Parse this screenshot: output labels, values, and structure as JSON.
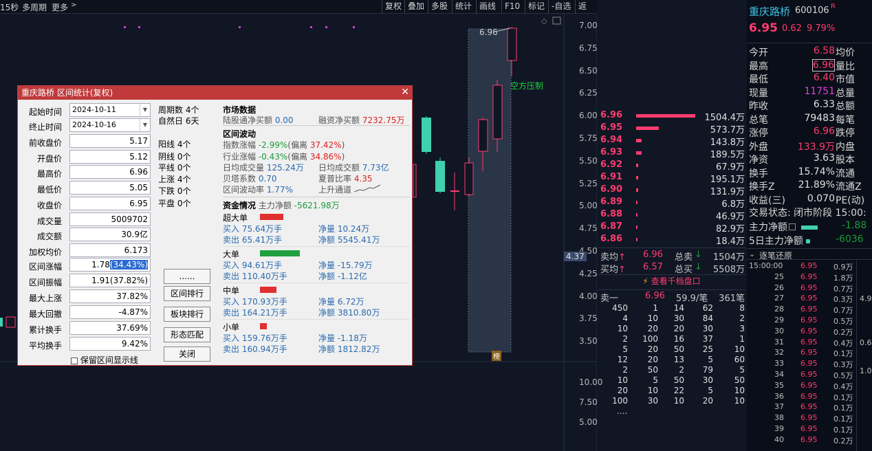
{
  "toolbar": {
    "period": "15秒",
    "multi": "多周期",
    "more": "更多",
    "buttons": [
      "复权",
      "叠加",
      "多股",
      "统计",
      "画线",
      "F10",
      "标记",
      "-自选",
      "返回"
    ]
  },
  "yaxis": [
    "7.00",
    "6.75",
    "6.50",
    "6.25",
    "6.00",
    "5.75",
    "5.50",
    "5.25",
    "5.00",
    "4.75",
    "4.50",
    "4.25",
    "4.00",
    "3.75",
    "3.50"
  ],
  "vol_axis": [
    "10.00",
    "7.50",
    "5.00"
  ],
  "price_tag": "4.37",
  "chart": {
    "high_label": "6.96",
    "annotation": "空方压制",
    "rank_tag": "榜"
  },
  "dialog": {
    "title": "重庆路桥 区间统计(复权)",
    "start_label": "起始时间",
    "start": "2024-10-11",
    "end_label": "终止时间",
    "end": "2024-10-16",
    "fields": [
      [
        "前收盘价",
        "5.17"
      ],
      [
        "开盘价",
        "5.12"
      ],
      [
        "最高价",
        "6.96"
      ],
      [
        "最低价",
        "5.05"
      ],
      [
        "收盘价",
        "6.95"
      ],
      [
        "成交量",
        "5009702"
      ],
      [
        "成交额",
        "30.9亿"
      ],
      [
        "加权均价",
        "6.173"
      ]
    ],
    "zf_label": "区间涨幅",
    "zf_val": "1.78",
    "zf_sel": "(34.43%)",
    "fields2": [
      [
        "区间振幅",
        "1.91(37.82%)"
      ],
      [
        "最大上涨",
        "37.82%"
      ],
      [
        "最大回撤",
        "-4.87%"
      ],
      [
        "累计换手",
        "37.69%"
      ],
      [
        "平均换手",
        "9.42%"
      ]
    ],
    "checkbox": "保留区间显示线",
    "mid": [
      "周期数 4个",
      "自然日 6天",
      "阳线 4个",
      "阴线 0个",
      "平线 0个",
      "上涨 4个",
      "下跌 0个",
      "平盘 0个"
    ],
    "buttons": [
      "......",
      "区间排行",
      "板块排行",
      "形态匹配",
      "关闭"
    ],
    "market_title": "市场数据",
    "lgt_label": "陆股通净买额",
    "lgt_val": "0.00",
    "rz_label": "融资净买额",
    "rz_val": "7232.75万",
    "wave_title": "区间波动",
    "idx_label": "指数涨幅",
    "idx_val": "-2.99%",
    "idx_dev": "(偏离 37.42%)",
    "ind_label": "行业涨幅",
    "ind_val": "-0.43%",
    "ind_dev": "(偏离 34.86%)",
    "avgv_label": "日均成交量",
    "avgv_val": "125.24万",
    "avga_label": "日均成交额",
    "avga_val": "7.73亿",
    "beta_label": "贝塔系数",
    "beta_val": "0.70",
    "sharpe_label": "夏普比率",
    "sharpe_val": "4.35",
    "vol_label": "区间波动率",
    "vol_val": "1.77%",
    "chan_label": "上升通道",
    "fund_title": "资金情况",
    "main_net": "主力净额 -5621.98万",
    "groups": [
      {
        "name": "超大单",
        "buy": "买入 75.64万手",
        "sell": "卖出 65.41万手",
        "net1": "净量 10.24万",
        "net2": "净额 5545.41万"
      },
      {
        "name": "大单",
        "buy": "买入 94.61万手",
        "sell": "卖出 110.40万手",
        "net1": "净量 -15.79万",
        "net2": "净额 -1.12亿"
      },
      {
        "name": "中单",
        "buy": "买入 170.93万手",
        "sell": "卖出 164.21万手",
        "net1": "净量 6.72万",
        "net2": "净额 3810.80万"
      },
      {
        "name": "小单",
        "buy": "买入 159.76万手",
        "sell": "卖出 160.94万手",
        "net1": "净量 -1.18万",
        "net2": "净额 1812.82万"
      }
    ]
  },
  "orderbook": [
    [
      "6.96",
      "1504.4万"
    ],
    [
      "6.95",
      "573.7万"
    ],
    [
      "6.94",
      "143.8万"
    ],
    [
      "6.93",
      "189.5万"
    ],
    [
      "6.92",
      "67.9万"
    ],
    [
      "6.91",
      "195.1万"
    ],
    [
      "6.90",
      "131.9万"
    ],
    [
      "6.89",
      "6.8万"
    ],
    [
      "6.88",
      "46.9万"
    ],
    [
      "6.87",
      "82.9万"
    ],
    [
      "6.86",
      "18.4万"
    ]
  ],
  "sell_avg": {
    "l": "卖均",
    "p": "6.96",
    "t": "总卖",
    "v": "1504万"
  },
  "buy_avg": {
    "l": "买均",
    "p": "6.57",
    "t": "总买",
    "v": "5508万"
  },
  "qiandang": "查看千档盘口",
  "sell1": {
    "l": "卖一",
    "p": "6.96",
    "q": "59.9/笔",
    "n": "361笔"
  },
  "queue": [
    [
      "450",
      "1",
      "14",
      "62",
      "8"
    ],
    [
      "4",
      "10",
      "30",
      "84",
      "2"
    ],
    [
      "10",
      "20",
      "20",
      "30",
      "3"
    ],
    [
      "2",
      "100",
      "16",
      "37",
      "1"
    ],
    [
      "5",
      "20",
      "50",
      "25",
      "10"
    ],
    [
      "12",
      "20",
      "13",
      "5",
      "60"
    ],
    [
      "2",
      "50",
      "2",
      "79",
      "5"
    ],
    [
      "10",
      "5",
      "50",
      "30",
      "50"
    ],
    [
      "20",
      "10",
      "22",
      "5",
      "10"
    ],
    [
      "100",
      "30",
      "10",
      "20",
      "10"
    ]
  ],
  "queue_more": "....",
  "quote": {
    "name": "重庆路桥",
    "code": "600106",
    "flag": "R",
    "price": "6.95",
    "chg": "0.62",
    "pct": "9.79%",
    "rows": [
      [
        "今开",
        "6.58",
        "均价"
      ],
      [
        "最高",
        "6.96",
        "量比"
      ],
      [
        "最低",
        "6.40",
        "市值"
      ],
      [
        "现量",
        "11751",
        "总量"
      ],
      [
        "昨收",
        "6.33",
        "总额"
      ],
      [
        "总笔",
        "79483",
        "每笔"
      ],
      [
        "涨停",
        "6.96",
        "跌停"
      ],
      [
        "外盘",
        "133.9万",
        "内盘"
      ],
      [
        "净资",
        "3.63",
        "股本"
      ],
      [
        "换手",
        "15.74%",
        "流通"
      ],
      [
        "换手Z",
        "21.89%",
        "流通Z"
      ],
      [
        "收益(三)",
        "0.070",
        "PE(动)"
      ]
    ],
    "status": "交易状态: 闭市阶段 15:00:",
    "mainnet_l": "主力净额",
    "mainnet_v": "-1.88",
    "main5_l": "5日主力净额",
    "main5_v": "-6036",
    "tick_title": "逐笔还原",
    "ticks": [
      [
        "15:00:00",
        "6.95",
        "0.9万"
      ],
      [
        "25",
        "6.95",
        "1.8万"
      ],
      [
        "26",
        "6.95",
        "0.7万"
      ],
      [
        "27",
        "6.95",
        "0.3万"
      ],
      [
        "28",
        "6.95",
        "0.7万"
      ],
      [
        "29",
        "6.95",
        "0.5万"
      ],
      [
        "30",
        "6.95",
        "0.2万"
      ],
      [
        "31",
        "6.95",
        "0.4万"
      ],
      [
        "32",
        "6.95",
        "0.1万"
      ],
      [
        "33",
        "6.95",
        "0.3万"
      ],
      [
        "34",
        "6.95",
        "0.5万"
      ],
      [
        "35",
        "6.95",
        "0.4万"
      ],
      [
        "36",
        "6.95",
        "0.1万"
      ],
      [
        "37",
        "6.95",
        "0.1万"
      ],
      [
        "38",
        "6.95",
        "0.1万"
      ],
      [
        "39",
        "6.95",
        "0.1万"
      ],
      [
        "40",
        "6.95",
        "0.2万"
      ]
    ],
    "side_vals": [
      "4.9",
      "0.6",
      "1.0"
    ]
  }
}
